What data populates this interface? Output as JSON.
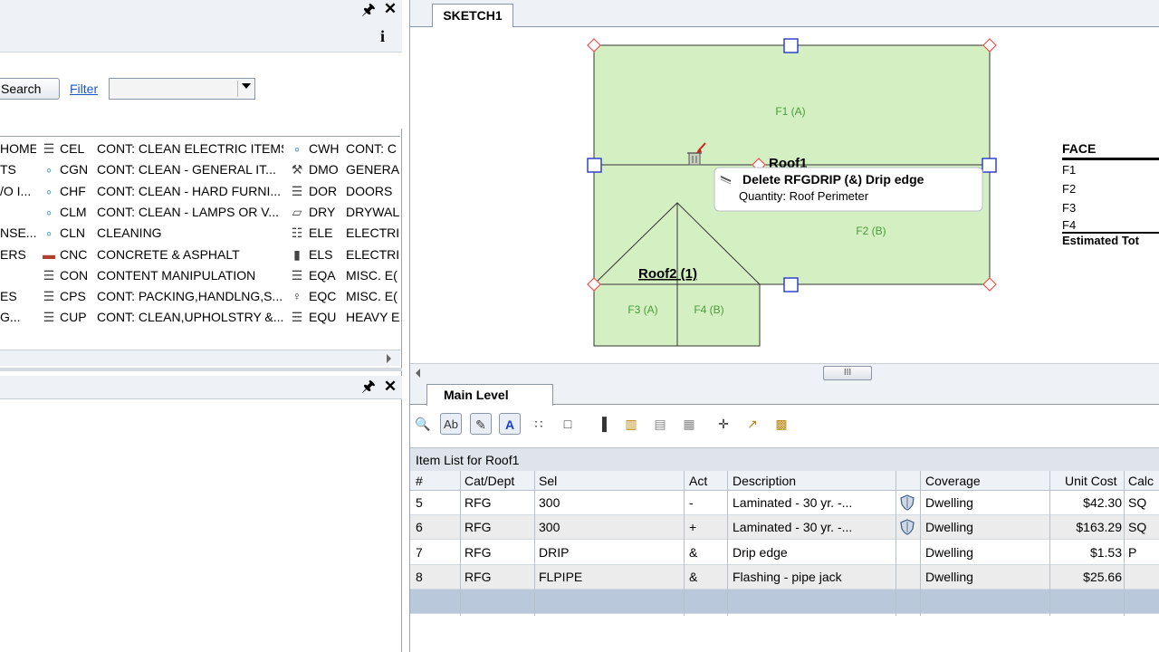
{
  "left_panel": {
    "search_button": "Search",
    "filter_label": "Filter",
    "filter_value": "",
    "info_icon": "i",
    "categories": [
      {
        "left": "HOME",
        "icon1": "notes-icon",
        "code1": "CEL",
        "desc1": "CONT: CLEAN ELECTRIC ITEMS",
        "icon2": "bubbles-icon",
        "code2": "CWH",
        "desc2": "CONT: C"
      },
      {
        "left": "TS",
        "icon1": "bubbles-icon",
        "code1": "CGN",
        "desc1": "CONT: CLEAN - GENERAL IT...",
        "icon2": "hammer-icon",
        "code2": "DMO",
        "desc2": "GENERA"
      },
      {
        "left": "/O I...",
        "icon1": "bubbles-icon",
        "code1": "CHF",
        "desc1": "CONT: CLEAN - HARD FURNI...",
        "icon2": "notes-icon",
        "code2": "DOR",
        "desc2": "DOORS"
      },
      {
        "left": "",
        "icon1": "bubbles-icon",
        "code1": "CLM",
        "desc1": "CONT: CLEAN - LAMPS OR V...",
        "icon2": "drywall-icon",
        "code2": "DRY",
        "desc2": "DRYWAL"
      },
      {
        "left": "NSE...",
        "icon1": "bubbles-icon",
        "code1": "CLN",
        "desc1": "CLEANING",
        "icon2": "outlet-icon",
        "code2": "ELE",
        "desc2": "ELECTRIC"
      },
      {
        "left": "ERS",
        "icon1": "concrete-icon",
        "code1": "CNC",
        "desc1": "CONCRETE & ASPHALT",
        "icon2": "battery-icon",
        "code2": "ELS",
        "desc2": "ELECTRIC"
      },
      {
        "left": "",
        "icon1": "notes-icon",
        "code1": "CON",
        "desc1": "CONTENT MANIPULATION",
        "icon2": "notes-icon",
        "code2": "EQA",
        "desc2": "MISC. E("
      },
      {
        "left": "ES",
        "icon1": "notes-icon",
        "code1": "CPS",
        "desc1": "CONT: PACKING,HANDLNG,S...",
        "icon2": "tag-icon",
        "code2": "EQC",
        "desc2": "MISC. E("
      },
      {
        "left": "G...",
        "icon1": "notes-icon",
        "code1": "CUP",
        "desc1": "CONT: CLEAN,UPHOLSTRY &...",
        "icon2": "notes-icon",
        "code2": "EQU",
        "desc2": "HEAVY E"
      }
    ]
  },
  "sketch": {
    "tab_label": "SKETCH1",
    "level_tab_label": "Main Level",
    "roof1_label": "Roof1",
    "roof2_label": "Roof2  (1)",
    "face_labels": {
      "f1": "F1 (A)",
      "f2": "F2 (B)",
      "f3": "F3 (A)",
      "f4": "F4 (B)"
    },
    "tooltip_title": "Delete RFGDRIP (&)  Drip edge",
    "tooltip_subtitle": "Quantity:  Roof Perimeter",
    "scroll_thumb": "III",
    "face_table": {
      "header": "FACE",
      "rows": [
        "F1",
        "F2",
        "F3",
        "F4"
      ],
      "footer": "Estimated Tot"
    },
    "fill_color": "#d4f0c2",
    "handle_color": "#2436c8",
    "vertex_color": "#e35050"
  },
  "item_list": {
    "title": "Item List for Roof1",
    "columns": [
      "#",
      "Cat/Dept",
      "Sel",
      "Act",
      "Description",
      "Coverage",
      "Unit Cost",
      "Calc"
    ],
    "rows": [
      {
        "num": "5",
        "cat": "RFG",
        "sel": "300",
        "act": "-",
        "desc": "Laminated - 30 yr. -...",
        "shield": true,
        "coverage": "Dwelling",
        "unit_cost": "$42.30",
        "calc": "SQ"
      },
      {
        "num": "6",
        "cat": "RFG",
        "sel": "300",
        "act": "+",
        "desc": "Laminated - 30 yr. -...",
        "shield": true,
        "coverage": "Dwelling",
        "unit_cost": "$163.29",
        "calc": "SQ"
      },
      {
        "num": "7",
        "cat": "RFG",
        "sel": "DRIP",
        "act": "&",
        "desc": "Drip edge",
        "shield": false,
        "coverage": "Dwelling",
        "unit_cost": "$1.53",
        "calc": "P"
      },
      {
        "num": "8",
        "cat": "RFG",
        "sel": "FLPIPE",
        "act": "&",
        "desc": "Flashing - pipe jack",
        "shield": false,
        "coverage": "Dwelling",
        "unit_cost": "$25.66",
        "calc": ""
      }
    ]
  }
}
